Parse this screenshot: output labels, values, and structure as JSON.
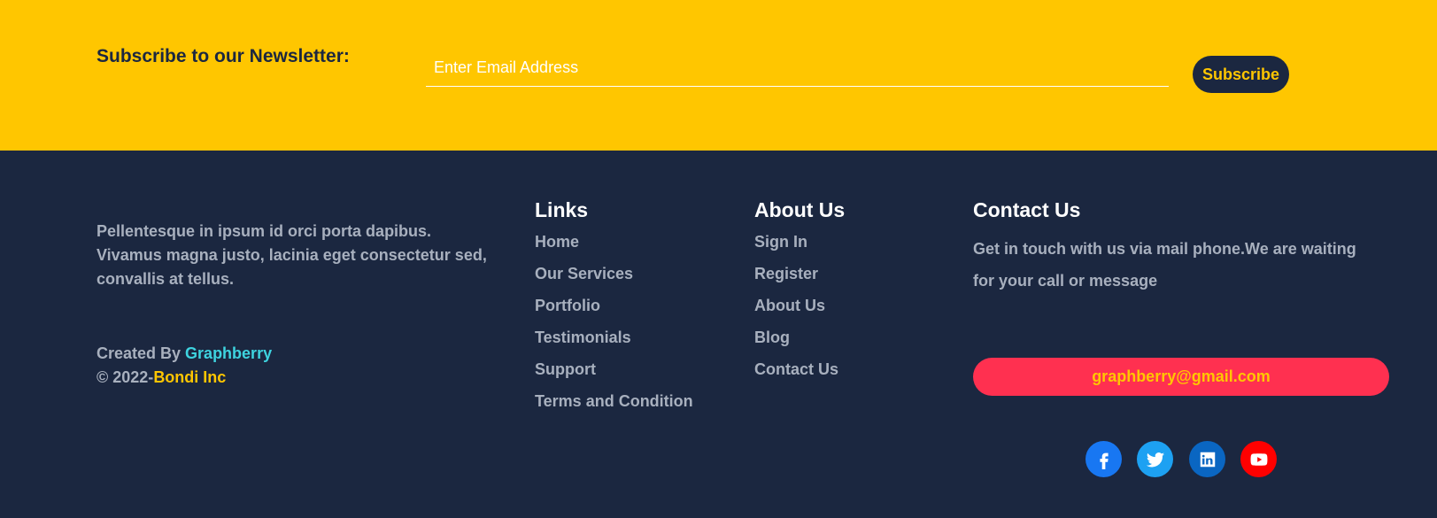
{
  "newsletter": {
    "title": "Subscribe to our Newsletter:",
    "email_placeholder": "Enter Email Address",
    "email_value": "",
    "subscribe_label": "Subscribe"
  },
  "footer": {
    "about_text": "Pellentesque in ipsum id orci porta dapibus. Vivamus magna justo, lacinia eget consectetur sed, convallis at tellus.",
    "credit": {
      "created_by_prefix": "Created By ",
      "created_by_link": "Graphberry",
      "copyright_prefix": "© 2022-",
      "copyright_link": "Bondi Inc"
    },
    "links": {
      "heading": "Links",
      "items": [
        "Home",
        "Our Services",
        "Portfolio",
        "Testimonials",
        "Support",
        "Terms and Condition"
      ]
    },
    "about_us": {
      "heading": "About Us",
      "items": [
        "Sign In",
        "Register",
        "About Us",
        "Blog",
        "Contact Us"
      ]
    },
    "contact": {
      "heading": "Contact Us",
      "text": "Get in touch with us via mail phone.We are waiting for your call or message",
      "email": "graphberry@gmail.com"
    },
    "social": [
      {
        "icon": "facebook-icon",
        "color": "#1877f2"
      },
      {
        "icon": "twitter-icon",
        "color": "#1da1f2"
      },
      {
        "icon": "linkedin-icon",
        "color": "#0a66c2"
      },
      {
        "icon": "youtube-icon",
        "color": "#ff0000"
      }
    ]
  },
  "colors": {
    "newsletter_bg": "#ffc600",
    "footer_bg": "#1b2740",
    "muted_text": "#a8b0be",
    "accent_cyan": "#3ed3df",
    "email_button_bg": "#ff3050"
  }
}
